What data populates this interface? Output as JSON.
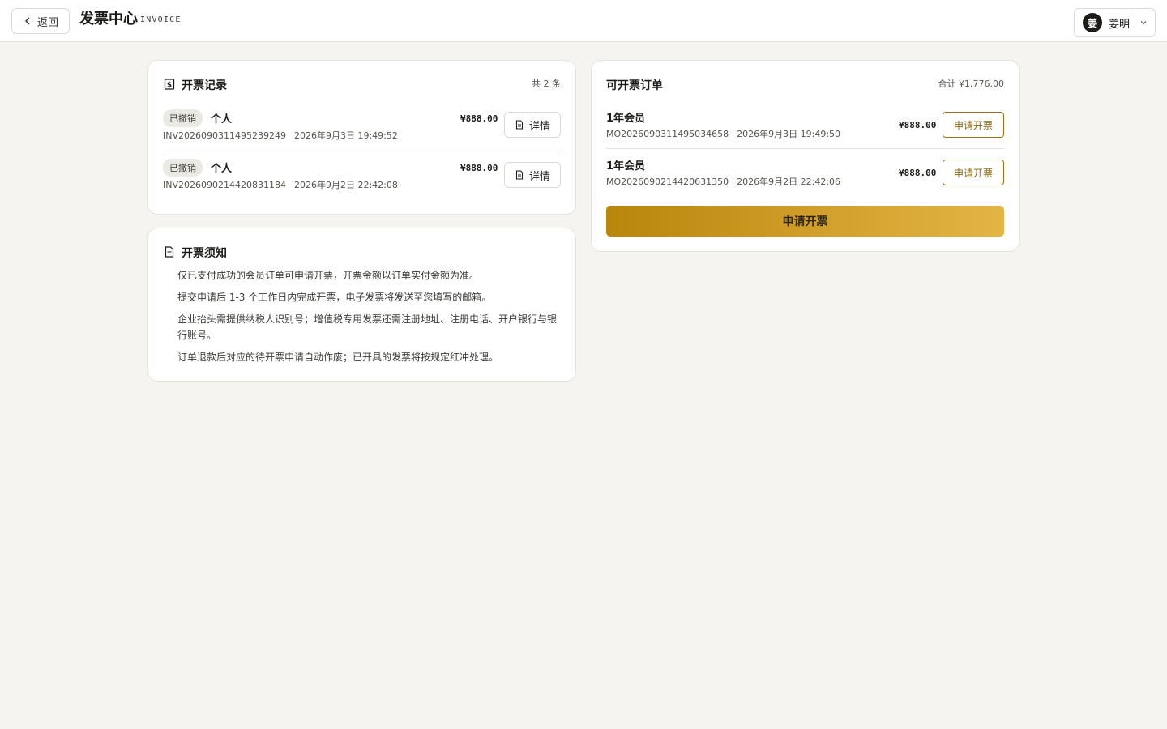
{
  "header": {
    "back_label": "返回",
    "title": "发票中心",
    "subtitle": "INVOICE",
    "user": {
      "avatar_char": "姜",
      "name": "姜明"
    }
  },
  "records": {
    "title": "开票记录",
    "count_label": "共 2 条",
    "items": [
      {
        "status": "已撤销",
        "type": "个人",
        "invoice_no": "INV2026090311495239249",
        "time": "2026年9月3日 19:49:52",
        "amount": "¥888.00",
        "detail_label": "详情"
      },
      {
        "status": "已撤销",
        "type": "个人",
        "invoice_no": "INV2026090214420831184",
        "time": "2026年9月2日 22:42:08",
        "amount": "¥888.00",
        "detail_label": "详情"
      }
    ]
  },
  "notice": {
    "title": "开票须知",
    "items": [
      "仅已支付成功的会员订单可申请开票，开票金额以订单实付金额为准。",
      "提交申请后 1-3 个工作日内完成开票，电子发票将发送至您填写的邮箱。",
      "企业抬头需提供纳税人识别号；增值税专用发票还需注册地址、注册电话、开户银行与银行账号。",
      "订单退款后对应的待开票申请自动作废；已开具的发票将按规定红冲处理。"
    ]
  },
  "orders": {
    "title": "可开票订单",
    "total_label": "合计 ¥1,776.00",
    "items": [
      {
        "title": "1年会员",
        "order_no": "MO2026090311495034658",
        "time": "2026年9月3日 19:49:50",
        "amount": "¥888.00",
        "apply_label": "申请开票"
      },
      {
        "title": "1年会员",
        "order_no": "MO2026090214420631350",
        "time": "2026年9月2日 22:42:06",
        "amount": "¥888.00",
        "apply_label": "申请开票"
      }
    ],
    "main_apply_label": "申请开票"
  },
  "colors": {
    "accent": "#b8860b",
    "background": "#f5f4f1"
  }
}
